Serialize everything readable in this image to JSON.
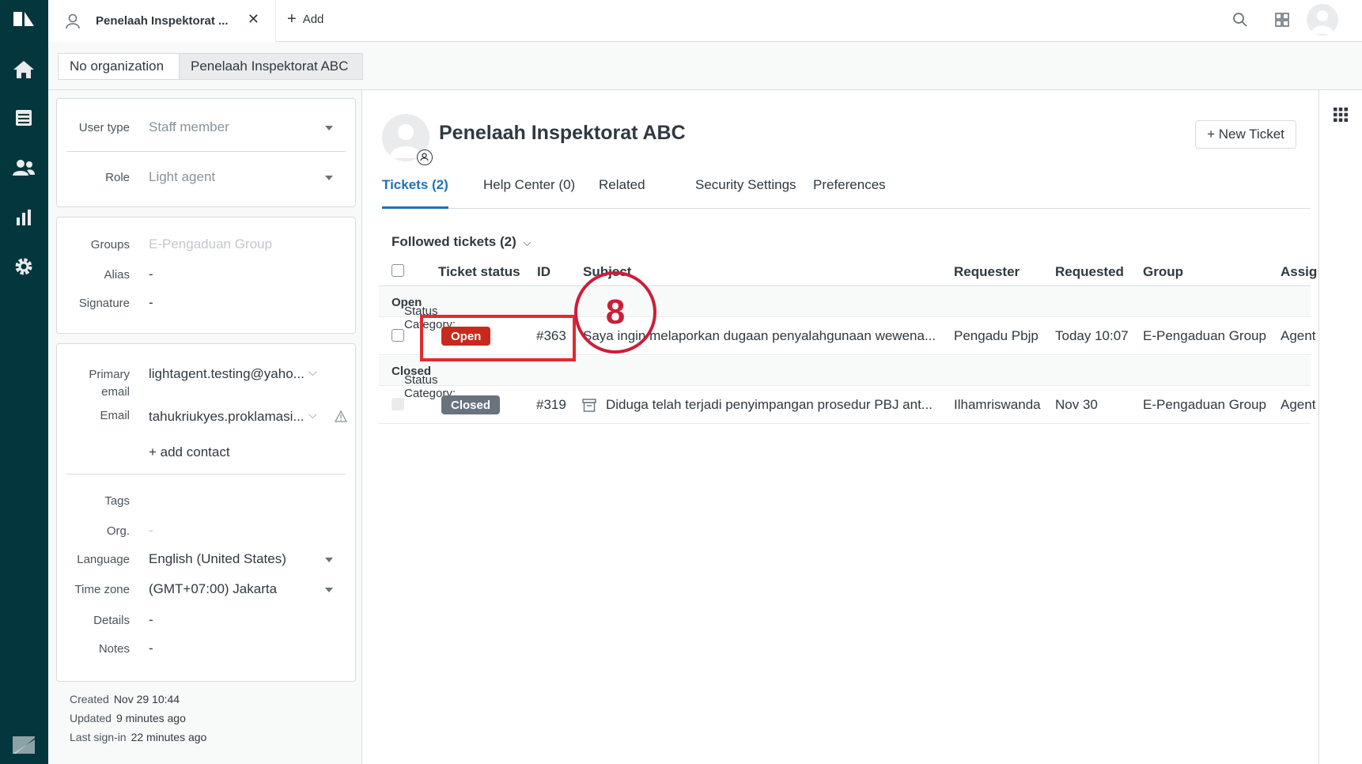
{
  "app": {
    "tab_title": "Penelaah Inspektorat ...",
    "add_label": "Add"
  },
  "breadcrumbs": [
    {
      "label": "No organization"
    },
    {
      "label": "Penelaah Inspektorat ABC"
    }
  ],
  "user_fields": {
    "user_type": {
      "label": "User type",
      "value": "Staff member"
    },
    "role": {
      "label": "Role",
      "value": "Light agent"
    },
    "groups": {
      "label": "Groups",
      "value": "E-Pengaduan Group"
    },
    "alias": {
      "label": "Alias",
      "value": "-"
    },
    "signature": {
      "label": "Signature",
      "value": "-"
    },
    "primary_email": {
      "label_line1": "Primary",
      "label_line2": "email",
      "value": "lightagent.testing@yaho..."
    },
    "email": {
      "label": "Email",
      "value": "tahukriukyes.proklamasi..."
    },
    "add_contact": "+ add contact",
    "tags": {
      "label": "Tags",
      "value": ""
    },
    "org": {
      "label": "Org.",
      "value": "-"
    },
    "language": {
      "label": "Language",
      "value": "English (United States)"
    },
    "time_zone": {
      "label": "Time zone",
      "value": "(GMT+07:00) Jakarta"
    },
    "details": {
      "label": "Details",
      "value": "-"
    },
    "notes": {
      "label": "Notes",
      "value": "-"
    }
  },
  "meta": {
    "created_label": "Created",
    "created_value": "Nov 29 10:44",
    "updated_label": "Updated",
    "updated_value": "9 minutes ago",
    "signin_label": "Last sign-in",
    "signin_value": "22 minutes ago"
  },
  "profile": {
    "name": "Penelaah Inspektorat ABC",
    "new_ticket_label": "+ New Ticket"
  },
  "tabs": [
    {
      "label": "Tickets (2)",
      "active": true
    },
    {
      "label": "Help Center (0)"
    },
    {
      "label": "Related"
    },
    {
      "label": "Security Settings"
    },
    {
      "label": "Preferences"
    }
  ],
  "tickets": {
    "followed_label": "Followed tickets (2)",
    "columns": [
      "Ticket status",
      "ID",
      "Subject",
      "Requester",
      "Requested",
      "Group",
      "Assig"
    ],
    "categories": [
      {
        "label": "Status Category:",
        "name": "Open",
        "rows": [
          {
            "status": "Open",
            "id": "#363",
            "subject": "Saya ingin melaporkan dugaan penyalahgunaan wewena...",
            "requester": "Pengadu Pbjp",
            "requested": "Today 10:07",
            "group": "E-Pengaduan Group",
            "assignee": "Agent"
          }
        ]
      },
      {
        "label": "Status Category:",
        "name": "Closed",
        "rows": [
          {
            "status": "Closed",
            "id": "#319",
            "subject": "Diduga telah terjadi penyimpangan prosedur PBJ ant...",
            "requester": "Ilhamriswanda",
            "requested": "Nov 30",
            "group": "E-Pengaduan Group",
            "assignee": "Agent"
          }
        ]
      }
    ]
  },
  "annotation": {
    "step": "8",
    "color": "#cc1d3a"
  },
  "colors": {
    "nav_bg": "#03363d",
    "open_badge": "#c72a1c",
    "closed_badge": "#68737d",
    "accent": "#1f73b7"
  }
}
